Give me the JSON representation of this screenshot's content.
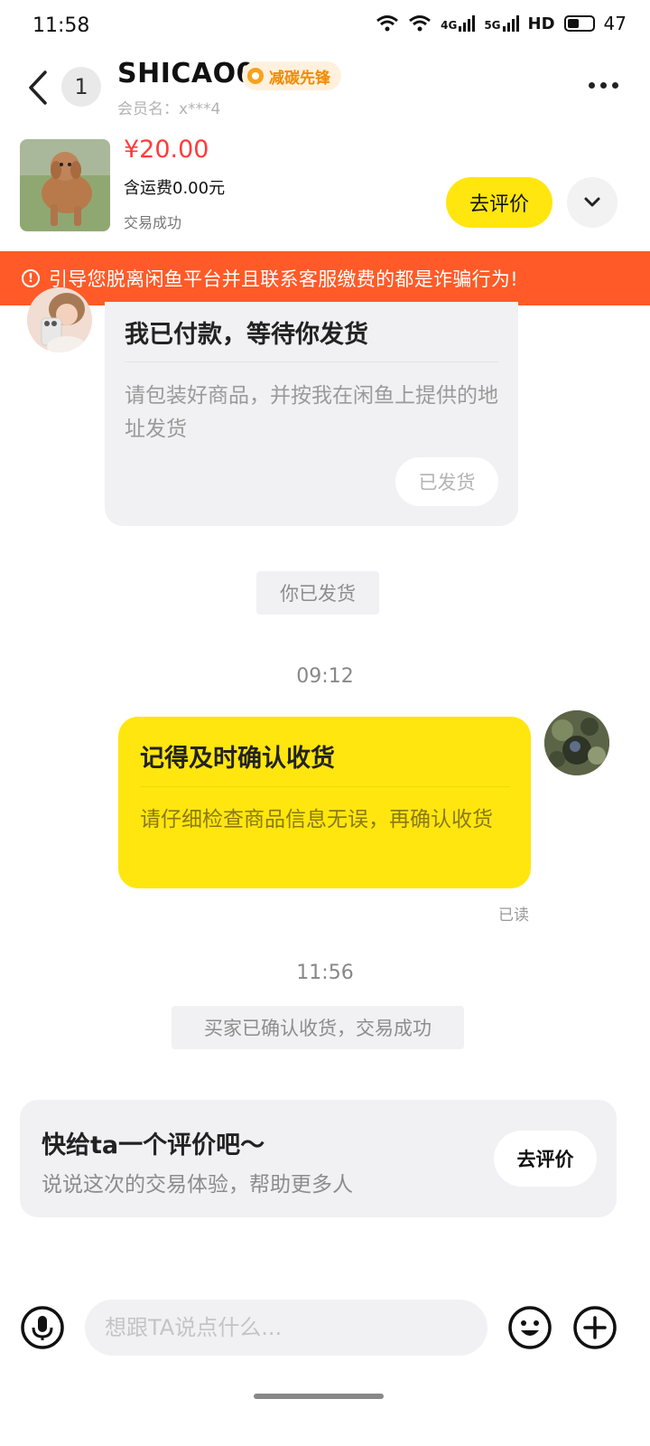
{
  "status_bar": {
    "time": "11:58",
    "network_4g": "4G",
    "network_5g": "5G",
    "hd": "HD",
    "battery": "47"
  },
  "header": {
    "unread_count": "1",
    "seller_name": "SHICAO0",
    "badge_label": "减碳先锋",
    "member_name": "会员名：x***4"
  },
  "product": {
    "image_icon": "dog-photo",
    "price": "¥20.00",
    "shipping": "含运费0.00元",
    "status": "交易成功",
    "review_button": "去评价"
  },
  "warning": {
    "text": "引导您脱离闲鱼平台并且联系客服缴费的都是诈骗行为!"
  },
  "messages": {
    "paid_card": {
      "title": "我已付款，等待你发货",
      "description": "请包装好商品，并按我在闲鱼上提供的地址发货",
      "button": "已发货"
    },
    "system_shipped": "你已发货",
    "timestamp_1": "09:12",
    "confirm_card": {
      "title": "记得及时确认收货",
      "description": "请仔细检查商品信息无误，再确认收货"
    },
    "read_label": "已读",
    "timestamp_2": "11:56",
    "system_success": "买家已确认收货，交易成功"
  },
  "review_prompt": {
    "title": "快给ta一个评价吧～",
    "subtitle": "说说这次的交易体验，帮助更多人",
    "button": "去评价"
  },
  "input_bar": {
    "placeholder": "想跟TA说点什么..."
  },
  "colors": {
    "accent_yellow": "#ffe60f",
    "warning_orange": "#ff5a28",
    "price_red": "#ff3b3b"
  }
}
